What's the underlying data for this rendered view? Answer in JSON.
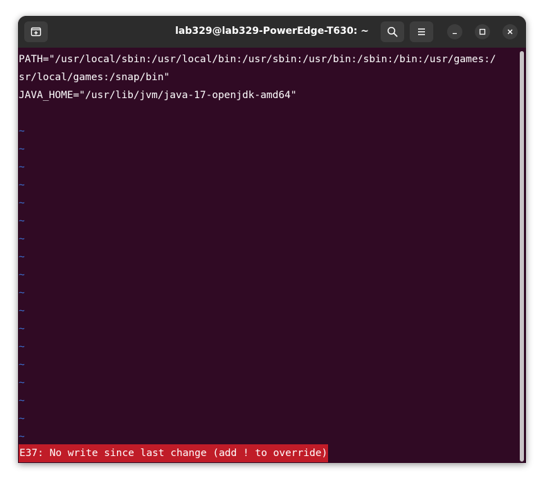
{
  "window": {
    "title": "lab329@lab329-PowerEdge-T630: ~"
  },
  "terminal": {
    "lines": [
      "PATH=\"/usr/local/sbin:/usr/local/bin:/usr/sbin:/usr/bin:/sbin:/bin:/usr/games:/",
      "sr/local/games:/snap/bin\"",
      "JAVA_HOME=\"/usr/lib/jvm/java-17-openjdk-amd64\""
    ],
    "tilde_char": "~",
    "status_message": "E37: No write since last change (add ! to override)"
  },
  "icons": {
    "new_tab": "new-tab-icon",
    "search": "search-icon",
    "menu": "hamburger-menu-icon",
    "minimize": "minimize-icon",
    "maximize": "maximize-icon",
    "close": "close-icon"
  },
  "colors": {
    "terminal_bg": "#300a24",
    "titlebar_bg": "#2c2c2c",
    "tilde": "#3b6fcf",
    "error_bg": "#c01c28"
  }
}
